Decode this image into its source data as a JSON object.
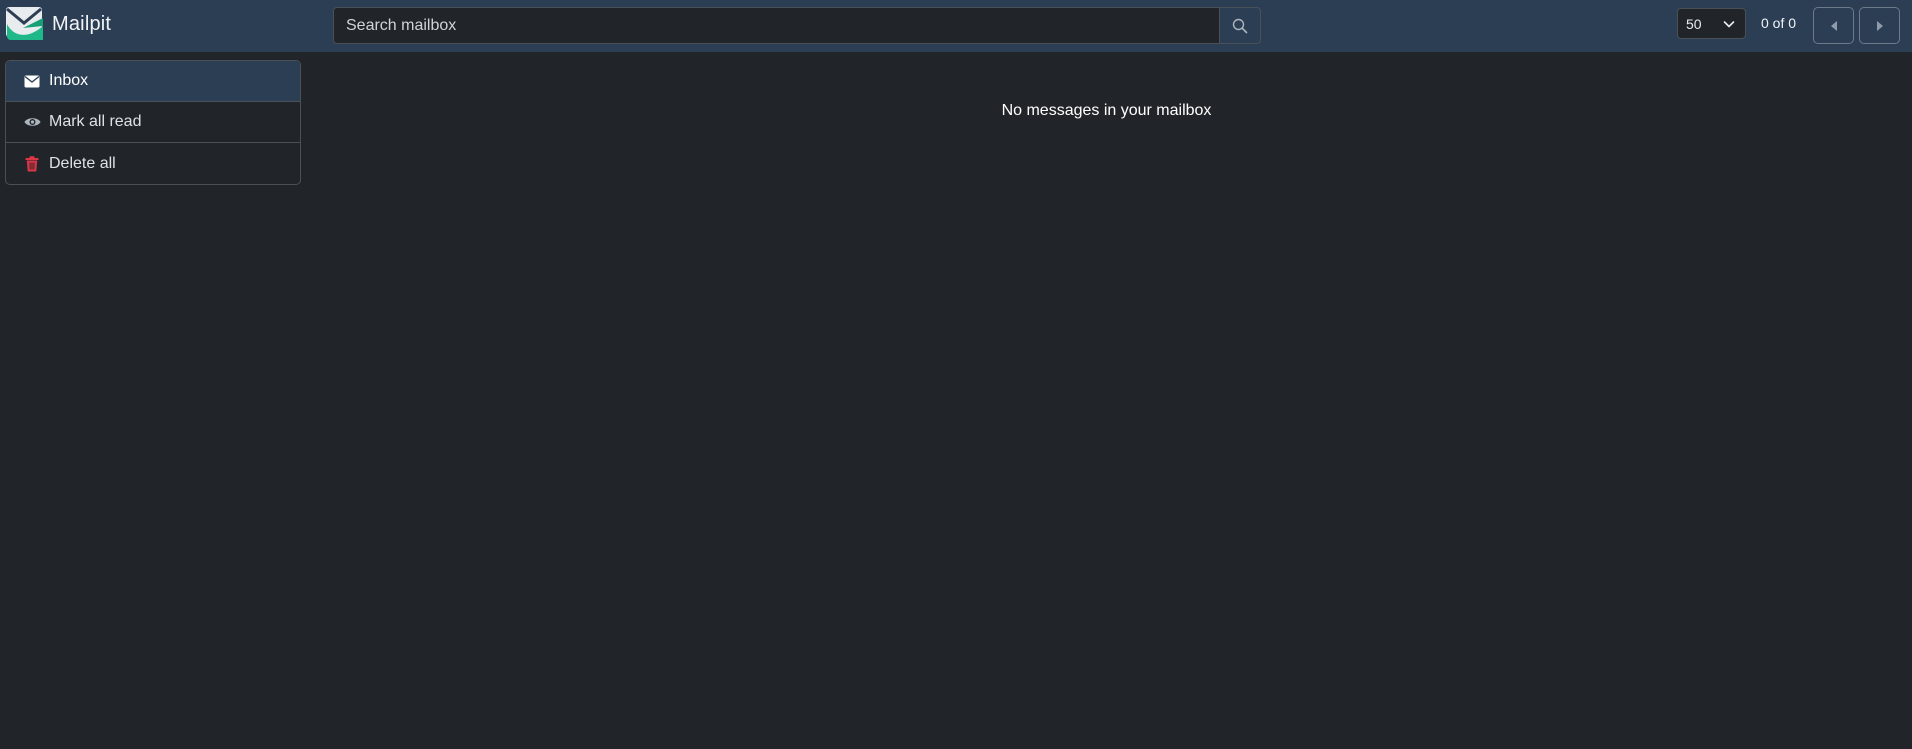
{
  "app": {
    "name": "Mailpit"
  },
  "search": {
    "placeholder": "Search mailbox"
  },
  "pagination": {
    "per_page": "50",
    "count_text": "0 of 0"
  },
  "sidebar": {
    "items": [
      {
        "label": "Inbox",
        "icon": "envelope-icon",
        "active": true
      },
      {
        "label": "Mark all read",
        "icon": "eye-icon"
      },
      {
        "label": "Delete all",
        "icon": "trash-icon",
        "color": "#dc3545"
      }
    ]
  },
  "main": {
    "empty_message": "No messages in your mailbox"
  },
  "colors": {
    "topbar": "#2c3e54",
    "background": "#212529",
    "brand_green": "#1fb889",
    "danger": "#dc3545"
  }
}
